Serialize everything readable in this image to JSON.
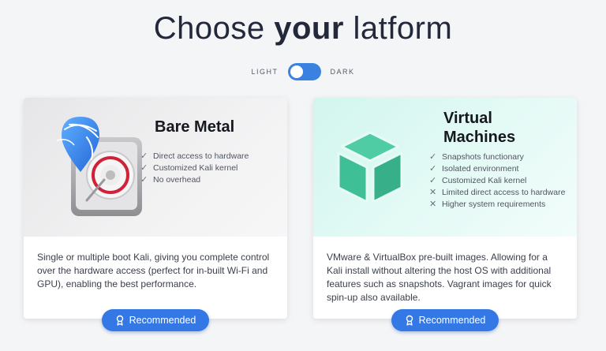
{
  "header": {
    "title_prefix": "Choose ",
    "title_bold": "your",
    "title_suffix": " latform"
  },
  "theme_toggle": {
    "light_label": "LIGHT",
    "dark_label": "DARK",
    "state": "light"
  },
  "cards": [
    {
      "title": "Bare Metal",
      "features": [
        {
          "type": "check",
          "text": "Direct access to hardware"
        },
        {
          "type": "check",
          "text": "Customized Kali kernel"
        },
        {
          "type": "check",
          "text": "No overhead"
        }
      ],
      "description": "Single or multiple boot Kali, giving you complete control over the hardware access (perfect for in-built Wi-Fi and GPU), enabling the best performance.",
      "button_label": "Recommended",
      "icon": "hard-drive-kali-icon"
    },
    {
      "title": "Virtual Machines",
      "features": [
        {
          "type": "check",
          "text": "Snapshots functionary"
        },
        {
          "type": "check",
          "text": "Isolated environment"
        },
        {
          "type": "check",
          "text": "Customized Kali kernel"
        },
        {
          "type": "cross",
          "text": "Limited direct access to hardware"
        },
        {
          "type": "cross",
          "text": "Higher system requirements"
        }
      ],
      "description": "VMware & VirtualBox pre-built images. Allowing for a Kali install without altering the host OS with additional features such as snapshots. Vagrant images for quick spin-up also available.",
      "button_label": "Recommended",
      "icon": "cube-icon"
    }
  ],
  "colors": {
    "accent": "#3478e5",
    "vm_green": "#3fbf96"
  }
}
